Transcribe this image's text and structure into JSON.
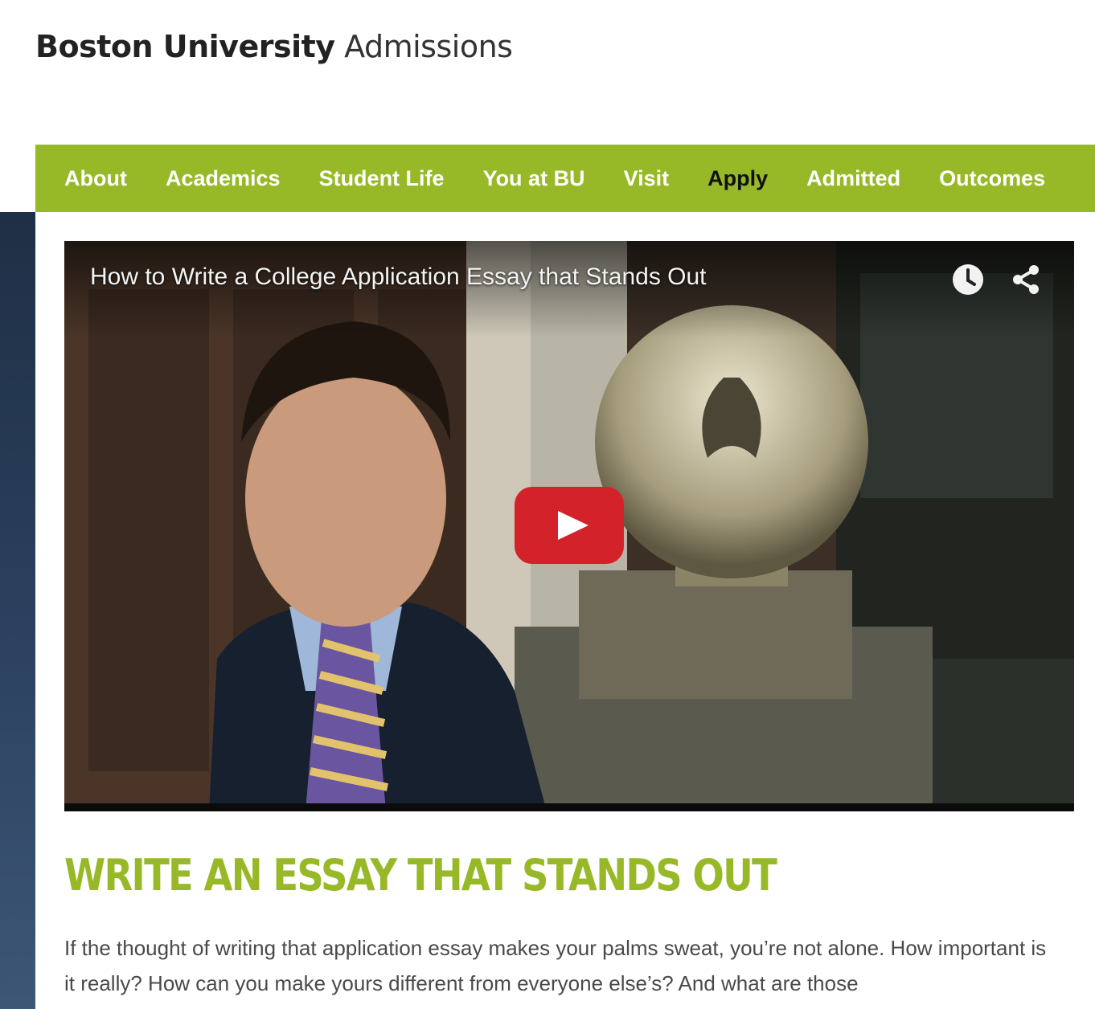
{
  "brand": {
    "name_bold": "Boston University",
    "name_light": "Admissions"
  },
  "nav": {
    "items": [
      {
        "label": "About"
      },
      {
        "label": "Academics"
      },
      {
        "label": "Student Life"
      },
      {
        "label": "You at BU"
      },
      {
        "label": "Visit"
      },
      {
        "label": "Apply",
        "active": true
      },
      {
        "label": "Admitted"
      },
      {
        "label": "Outcomes"
      }
    ]
  },
  "video": {
    "title": "How to Write a College Application Essay that Stands Out",
    "controls": {
      "watch_later_icon": "clock-icon",
      "share_icon": "share-icon",
      "play_icon": "play-icon"
    }
  },
  "article": {
    "headline": "WRITE AN ESSAY THAT STANDS OUT",
    "paragraph": "If the thought of writing that application essay makes your palms sweat, you’re not alone. How important is it really? How can you make yours different from everyone else’s? And what are those"
  },
  "colors": {
    "brand_green": "#98b927",
    "nav_text": "#ffffff",
    "nav_active": "#111111",
    "sidebar": "#2c4260",
    "play_red": "#d3222a"
  }
}
